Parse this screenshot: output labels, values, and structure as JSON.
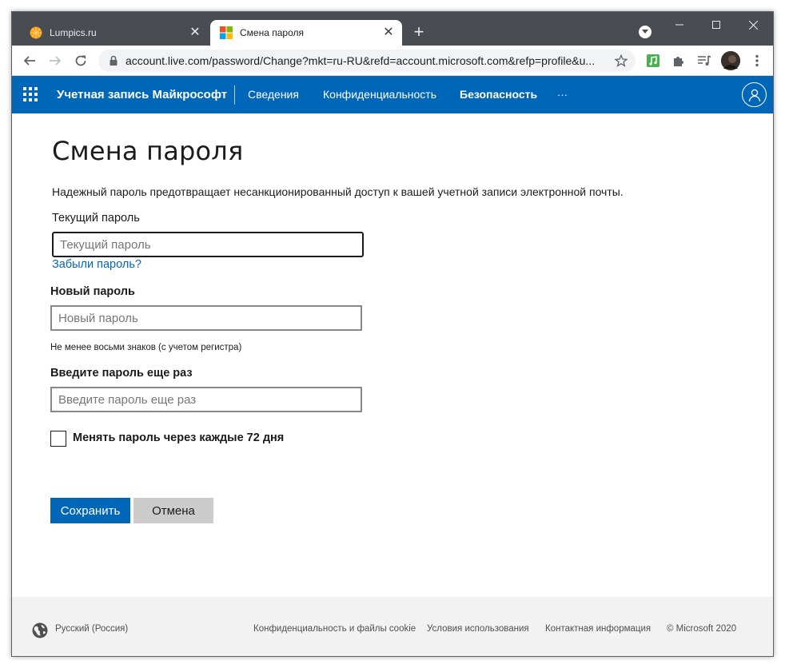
{
  "browser": {
    "tabs": [
      {
        "title": "Lumpics.ru",
        "favicon": "orange-circle-icon",
        "active": false
      },
      {
        "title": "Смена пароля",
        "favicon": "microsoft-logo-icon",
        "active": true
      }
    ],
    "url": "account.live.com/password/Change?mkt=ru-RU&refd=account.microsoft.com&refp=profile&u..."
  },
  "header": {
    "brand": "Учетная запись Майкрософт",
    "nav": [
      "Сведения",
      "Конфиденциальность",
      "Безопасность"
    ],
    "more": "···",
    "accent_color": "#0067b8"
  },
  "main": {
    "title": "Смена пароля",
    "description": "Надежный пароль предотвращает несанкционированный доступ к вашей учетной записи электронной почты.",
    "current_password": {
      "label": "Текущий пароль",
      "placeholder": "Текущий пароль",
      "value": ""
    },
    "forgot_link": "Забыли пароль?",
    "new_password": {
      "label": "Новый пароль",
      "placeholder": "Новый пароль",
      "value": ""
    },
    "hint": "Не менее восьми знаков (с учетом регистра)",
    "confirm_password": {
      "label": "Введите пароль еще раз",
      "placeholder": "Введите пароль еще раз",
      "value": ""
    },
    "checkbox": {
      "label": "Менять пароль через каждые 72 дня",
      "checked": false
    },
    "save_label": "Сохранить",
    "cancel_label": "Отмена"
  },
  "footer": {
    "language": "Русский (Россия)",
    "privacy": "Конфиденциальность и файлы cookie",
    "terms": "Условия использования",
    "contact": "Контактная информация",
    "copyright": "© Microsoft 2020"
  }
}
